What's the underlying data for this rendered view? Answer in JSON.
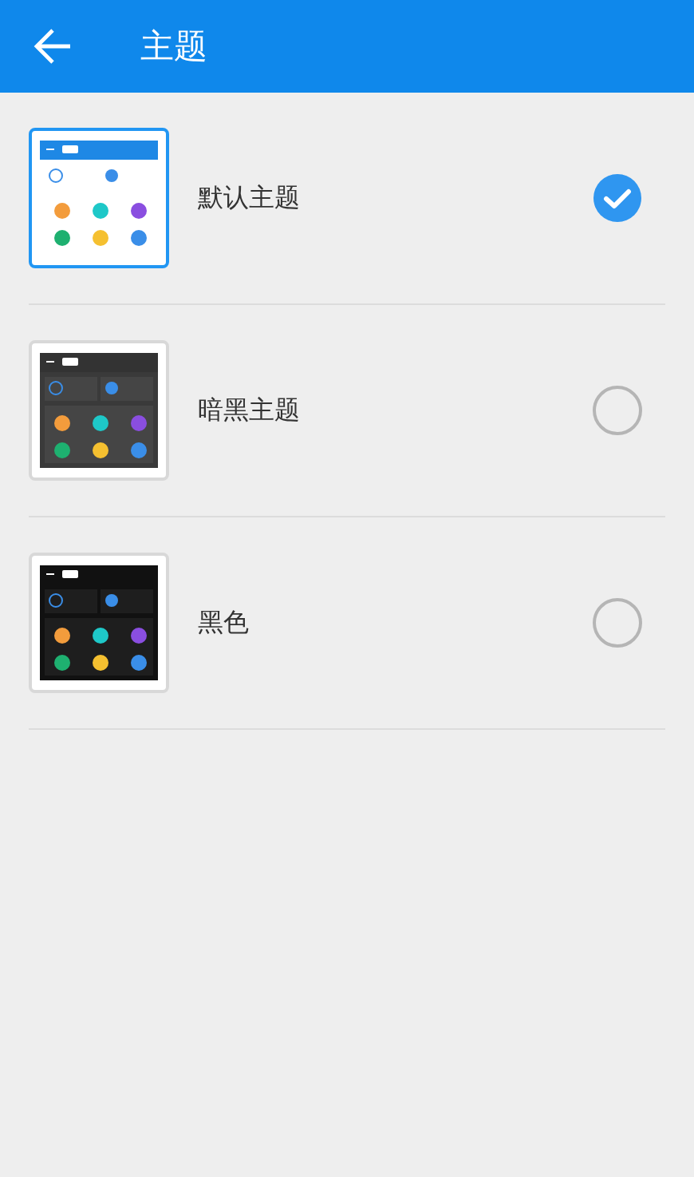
{
  "header": {
    "title": "主题"
  },
  "themes": [
    {
      "name": "默认主题",
      "kind": "light",
      "selected": true
    },
    {
      "name": "暗黑主题",
      "kind": "dark",
      "selected": false
    },
    {
      "name": "黑色",
      "kind": "black",
      "selected": false
    }
  ]
}
